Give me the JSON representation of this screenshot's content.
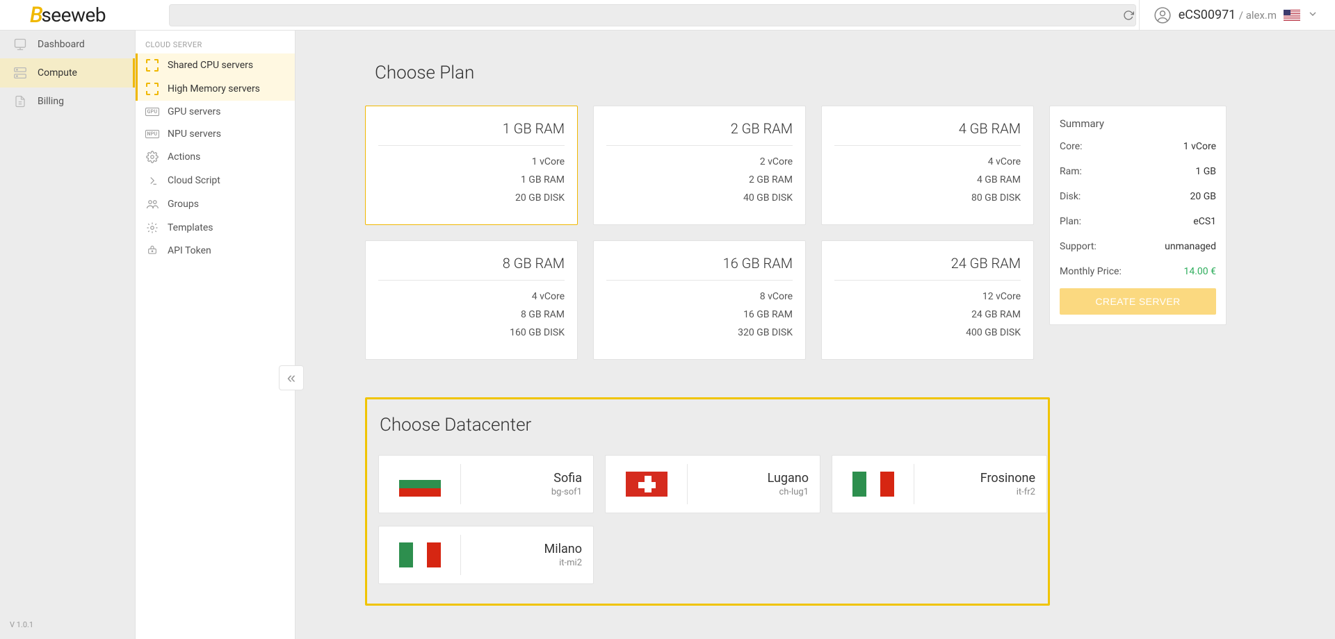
{
  "brand": {
    "prefix": "B",
    "name": "seeweb"
  },
  "search": {
    "placeholder": ""
  },
  "account": {
    "id": "eCS00971",
    "user": "alex.m"
  },
  "sidebar_primary": {
    "items": [
      {
        "label": "Dashboard",
        "icon": "dashboard-icon"
      },
      {
        "label": "Compute",
        "icon": "compute-icon"
      },
      {
        "label": "Billing",
        "icon": "billing-icon"
      }
    ],
    "active_index": 1
  },
  "version": "V 1.0.1",
  "sidebar_secondary": {
    "header": "CLOUD SERVER",
    "items": [
      {
        "label": "Shared CPU servers"
      },
      {
        "label": "High Memory servers"
      },
      {
        "label": "GPU servers",
        "badge": "GPU"
      },
      {
        "label": "NPU servers",
        "badge": "NPU"
      },
      {
        "label": "Actions"
      },
      {
        "label": "Cloud Script"
      },
      {
        "label": "Groups"
      },
      {
        "label": "Templates"
      },
      {
        "label": "API Token"
      }
    ],
    "highlight_indices": [
      0,
      1
    ]
  },
  "sections": {
    "plan_title": "Choose Plan",
    "datacenter_title": "Choose Datacenter"
  },
  "plans": [
    {
      "heading": "1 GB RAM",
      "core": "1 vCore",
      "ram": "1 GB RAM",
      "disk": "20 GB DISK",
      "selected": true
    },
    {
      "heading": "2 GB RAM",
      "core": "2 vCore",
      "ram": "2 GB RAM",
      "disk": "40 GB DISK"
    },
    {
      "heading": "4 GB RAM",
      "core": "4 vCore",
      "ram": "4 GB RAM",
      "disk": "80 GB DISK"
    },
    {
      "heading": "8 GB RAM",
      "core": "4 vCore",
      "ram": "8 GB RAM",
      "disk": "160 GB DISK"
    },
    {
      "heading": "16 GB RAM",
      "core": "8 vCore",
      "ram": "16 GB RAM",
      "disk": "320 GB DISK"
    },
    {
      "heading": "24 GB RAM",
      "core": "12 vCore",
      "ram": "24 GB RAM",
      "disk": "400 GB DISK"
    }
  ],
  "summary": {
    "title": "Summary",
    "rows": [
      {
        "label": "Core:",
        "value": "1 vCore"
      },
      {
        "label": "Ram:",
        "value": "1 GB"
      },
      {
        "label": "Disk:",
        "value": "20 GB"
      },
      {
        "label": "Plan:",
        "value": "eCS1"
      },
      {
        "label": "Support:",
        "value": "unmanaged"
      }
    ],
    "price_label": "Monthly Price:",
    "price_value": "14.00 €",
    "create_label": "CREATE SERVER"
  },
  "datacenters": [
    {
      "name": "Sofia",
      "code": "bg-sof1",
      "flag": "bg"
    },
    {
      "name": "Lugano",
      "code": "ch-lug1",
      "flag": "ch"
    },
    {
      "name": "Frosinone",
      "code": "it-fr2",
      "flag": "it"
    },
    {
      "name": "Milano",
      "code": "it-mi2",
      "flag": "it"
    }
  ]
}
